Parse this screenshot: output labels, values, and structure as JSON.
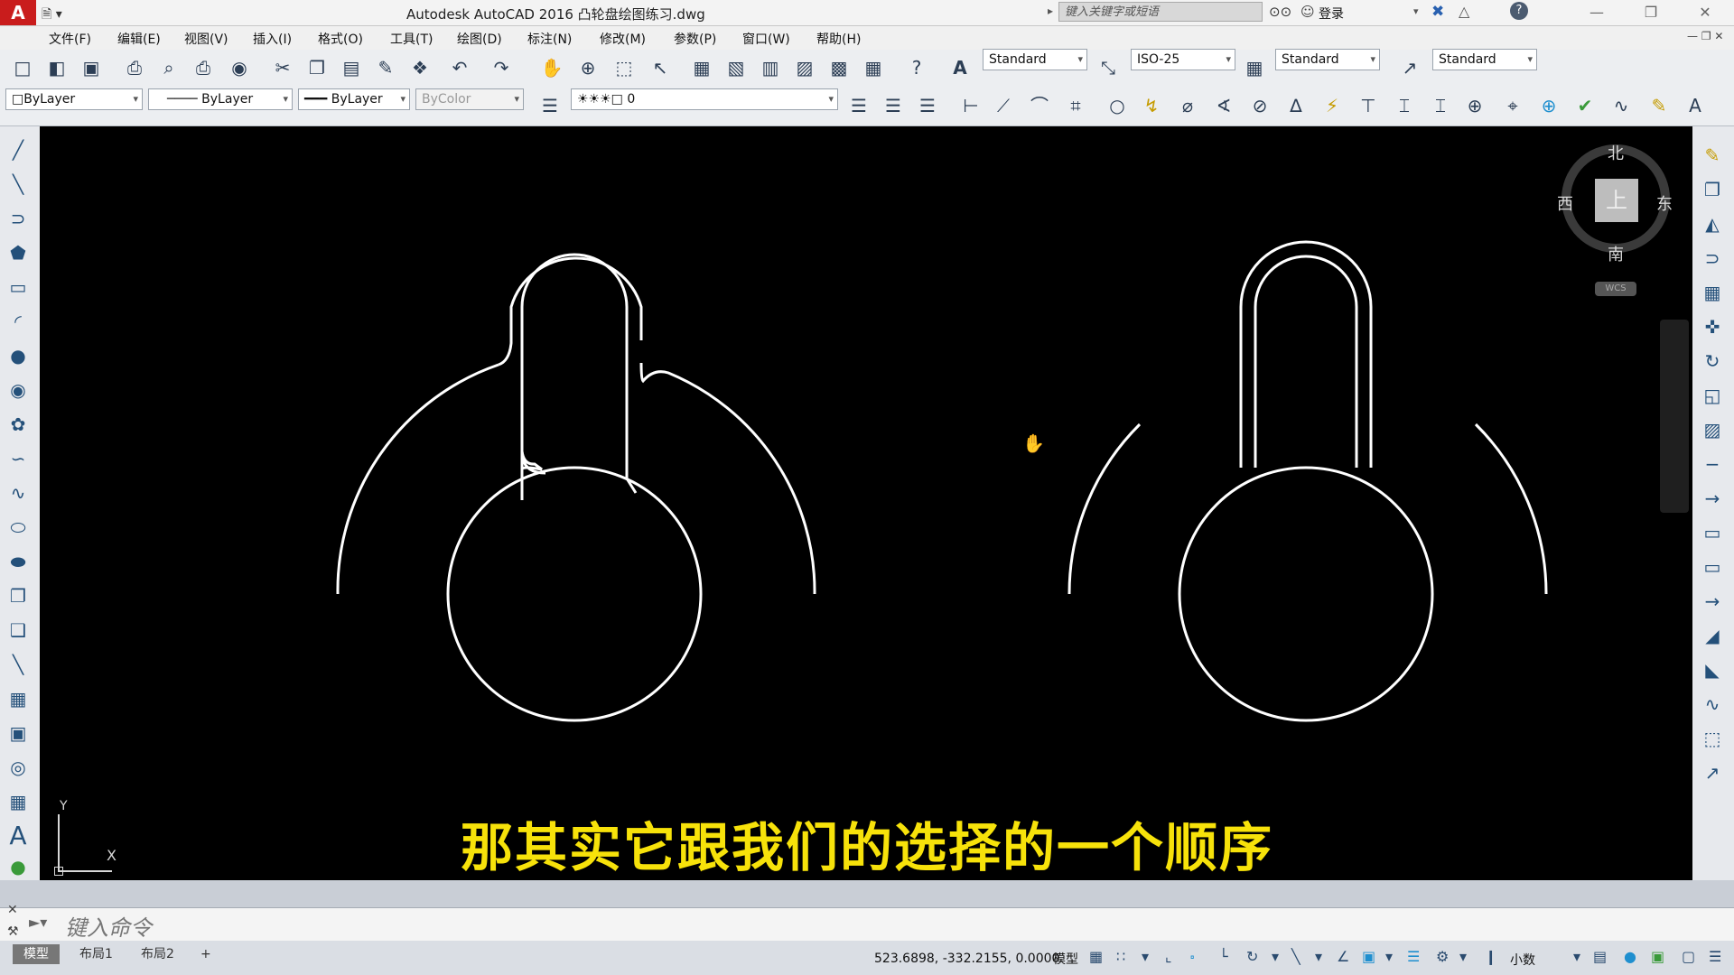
{
  "app": {
    "logo": "A",
    "title": "Autodesk AutoCAD 2016    凸轮盘绘图练习.dwg",
    "search_placeholder": "键入关键字或短语",
    "login": "登录"
  },
  "menu": [
    "文件(F)",
    "编辑(E)",
    "视图(V)",
    "插入(I)",
    "格式(O)",
    "工具(T)",
    "绘图(D)",
    "标注(N)",
    "修改(M)",
    "参数(P)",
    "窗口(W)",
    "帮助(H)"
  ],
  "styles": {
    "text_style": "Standard",
    "dim_style": "ISO-25",
    "table_style": "Standard",
    "multileader_style": "Standard"
  },
  "properties": {
    "color": "ByLayer",
    "linetype": "ByLayer",
    "lineweight": "ByLayer",
    "plotstyle": "ByColor",
    "layer": "0"
  },
  "viewcube": {
    "north": "北",
    "south": "南",
    "east": "东",
    "west": "西",
    "top": "上",
    "wcs": "WCS"
  },
  "ucs": {
    "x": "X",
    "y": "Y"
  },
  "subtitle": "那其实它跟我们的选择的一个顺序",
  "command": {
    "placeholder": "键入命令"
  },
  "layout_tabs": [
    "模型",
    "布局1",
    "布局2",
    "+"
  ],
  "status": {
    "coordinates": "523.6898, -332.2155, 0.0000",
    "model": "模型",
    "units": "小数"
  },
  "colors": {
    "canvas": "#000000",
    "geometry": "#ffffff",
    "subtitle": "#f7e20a"
  }
}
